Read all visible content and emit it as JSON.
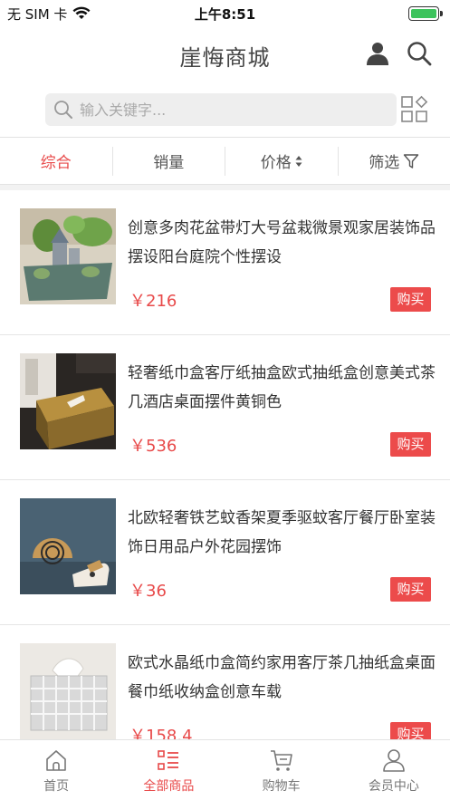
{
  "status_bar": {
    "carrier": "无 SIM 卡",
    "time": "上午8:51"
  },
  "nav": {
    "title": "崖悔商城"
  },
  "search": {
    "placeholder": "输入关键字..."
  },
  "filters": [
    {
      "label": "综合",
      "active": true
    },
    {
      "label": "销量",
      "active": false
    },
    {
      "label": "价格",
      "active": false
    },
    {
      "label": "筛选",
      "active": false
    }
  ],
  "products": [
    {
      "title": "创意多肉花盆带灯大号盆栽微景观家居装饰品摆设阳台庭院个性摆设",
      "price": "￥216",
      "buy": "购买",
      "image": "succulent-planter-image"
    },
    {
      "title": "轻奢纸巾盒客厅纸抽盒欧式抽纸盒创意美式茶几酒店桌面摆件黄铜色",
      "price": "￥536",
      "buy": "购买",
      "image": "tissue-box-image"
    },
    {
      "title": "北欧轻奢铁艺蚊香架夏季驱蚊客厅餐厅卧室装饰日用品户外花园摆饰",
      "price": "￥36",
      "buy": "购买",
      "image": "mosquito-coil-holder-image"
    },
    {
      "title": "欧式水晶纸巾盒简约家用客厅茶几抽纸盒桌面餐巾纸收纳盒创意车载",
      "price": "￥158.4",
      "buy": "购买",
      "image": "crystal-tissue-box-image"
    }
  ],
  "tabs": [
    {
      "label": "首页",
      "icon": "home-icon",
      "active": false
    },
    {
      "label": "全部商品",
      "icon": "list-icon",
      "active": true
    },
    {
      "label": "购物车",
      "icon": "cart-icon",
      "active": false
    },
    {
      "label": "会员中心",
      "icon": "user-icon",
      "active": false
    }
  ],
  "colors": {
    "accent": "#e84a4a",
    "buy_button": "#ec4b4b",
    "battery": "#3cc35c"
  }
}
